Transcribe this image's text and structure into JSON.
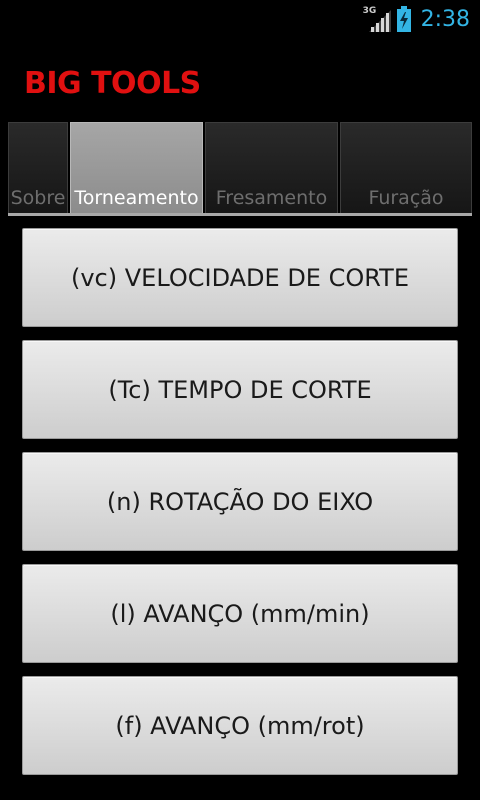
{
  "status_bar": {
    "network_type": "3G",
    "time": "2:38",
    "icons": [
      "signal-icon",
      "battery-charging-icon"
    ]
  },
  "app": {
    "title": "BIG TOOLS",
    "title_color": "#e01010"
  },
  "tabs": [
    {
      "label": "Sobre",
      "active": false
    },
    {
      "label": "Torneamento",
      "active": true
    },
    {
      "label": "Fresamento",
      "active": false
    },
    {
      "label": "Furação",
      "active": false
    }
  ],
  "buttons": [
    {
      "label": "(vc) VELOCIDADE DE CORTE"
    },
    {
      "label": "(Tc) TEMPO DE CORTE"
    },
    {
      "label": "(n) ROTAÇÃO DO EIXO"
    },
    {
      "label": "(l) AVANÇO (mm/min)"
    },
    {
      "label": "(f) AVANÇO (mm/rot)"
    }
  ],
  "colors": {
    "background": "#000000",
    "clock": "#33b5e5",
    "active_tab": "#9a9a9a"
  }
}
